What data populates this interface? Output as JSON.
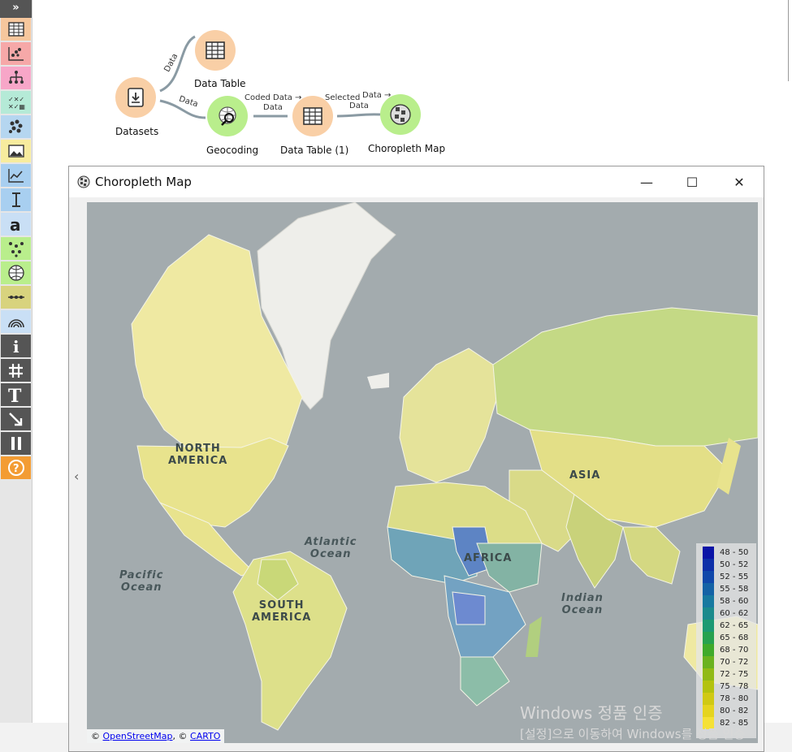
{
  "toolbox": {
    "expand_label": "»",
    "buttons": [
      {
        "icon": "table-icon",
        "color": "#f6c79d"
      },
      {
        "icon": "scatter-icon",
        "color": "#f6a8a8"
      },
      {
        "icon": "tree-icon",
        "color": "#f7a6c8"
      },
      {
        "icon": "confusion-matrix-icon",
        "color": "#b5ead7"
      },
      {
        "icon": "cluster-icon",
        "color": "#b5d6f0"
      },
      {
        "icon": "image-icon",
        "color": "#f7ec9e"
      },
      {
        "icon": "line-chart-icon",
        "color": "#a8cff0"
      },
      {
        "icon": "text-cursor-icon",
        "color": "#a8cff0"
      },
      {
        "icon": "letter-a-icon",
        "color": "#c9dff5"
      },
      {
        "icon": "network-icon",
        "color": "#b9ee8c"
      },
      {
        "icon": "globe-icon",
        "color": "#b9ee8c"
      },
      {
        "icon": "timeline-icon",
        "color": "#d8d37e"
      },
      {
        "icon": "arc-icon",
        "color": "#c9dff5"
      },
      {
        "icon": "info-icon",
        "color": "#555555"
      },
      {
        "icon": "grid-icon",
        "color": "#555555"
      },
      {
        "icon": "text-annotation-icon",
        "color": "#555555"
      },
      {
        "icon": "arrow-annotation-icon",
        "color": "#555555"
      },
      {
        "icon": "pause-icon",
        "color": "#555555"
      },
      {
        "icon": "help-icon",
        "color": "#f39c33"
      }
    ]
  },
  "workflow": {
    "nodes": [
      {
        "label": "Datasets",
        "icon": "datasets-icon"
      },
      {
        "label": "Data Table",
        "icon": "table-icon"
      },
      {
        "label": "Geocoding",
        "icon": "geocoding-icon"
      },
      {
        "label": "Data Table (1)",
        "icon": "table-icon"
      },
      {
        "label": "Choropleth Map",
        "icon": "choropleth-icon"
      }
    ],
    "links": {
      "datasets_to_table": "Data",
      "datasets_to_geocoding": "Data",
      "geocoding_to_table1_a": "Coded",
      "geocoding_to_table1_b": "Data",
      "geocoding_to_table1_c": "Data →",
      "table1_to_map_a": "Selected",
      "table1_to_map_b": "Data",
      "table1_to_map_c": "Data →"
    }
  },
  "window": {
    "title": "Choropleth Map",
    "minimize": "—",
    "maximize": "☐",
    "close": "✕",
    "side_chevron": "‹"
  },
  "map": {
    "continents": {
      "north_america_1": "NORTH",
      "north_america_2": "AMERICA",
      "south_america_1": "SOUTH",
      "south_america_2": "AMERICA",
      "africa": "AFRICA",
      "asia": "ASIA"
    },
    "oceans": {
      "atlantic_1": "Atlantic",
      "atlantic_2": "Ocean",
      "pacific_1": "Pacific",
      "pacific_2": "Ocean",
      "indian_1": "Indian",
      "indian_2": "Ocean"
    },
    "attribution": {
      "copyright": "©",
      "osm": "OpenStreetMap",
      "sep": ", ©",
      "carto": "CARTO"
    },
    "legend": [
      {
        "label": "48 - 50",
        "color": "#0a14a6"
      },
      {
        "label": "50 - 52",
        "color": "#0d2fa8"
      },
      {
        "label": "52 - 55",
        "color": "#1048aa"
      },
      {
        "label": "55 - 58",
        "color": "#1462a6"
      },
      {
        "label": "58 - 60",
        "color": "#1779a0"
      },
      {
        "label": "60 - 62",
        "color": "#1a8a8d"
      },
      {
        "label": "62 - 65",
        "color": "#1d9a72"
      },
      {
        "label": "65 - 68",
        "color": "#27a24f"
      },
      {
        "label": "68 - 70",
        "color": "#3faa2a"
      },
      {
        "label": "70 - 72",
        "color": "#6ab21e"
      },
      {
        "label": "72 - 75",
        "color": "#91ba14"
      },
      {
        "label": "75 - 78",
        "color": "#b3c20e"
      },
      {
        "label": "78 - 80",
        "color": "#d0c913"
      },
      {
        "label": "80 - 82",
        "color": "#e5d41e"
      },
      {
        "label": "82 - 85",
        "color": "#f5e135"
      }
    ]
  },
  "os_watermark": {
    "line1": "Windows 정품 인증",
    "line2": "[설정]으로 이동하여 Windows를 정품 인증"
  }
}
